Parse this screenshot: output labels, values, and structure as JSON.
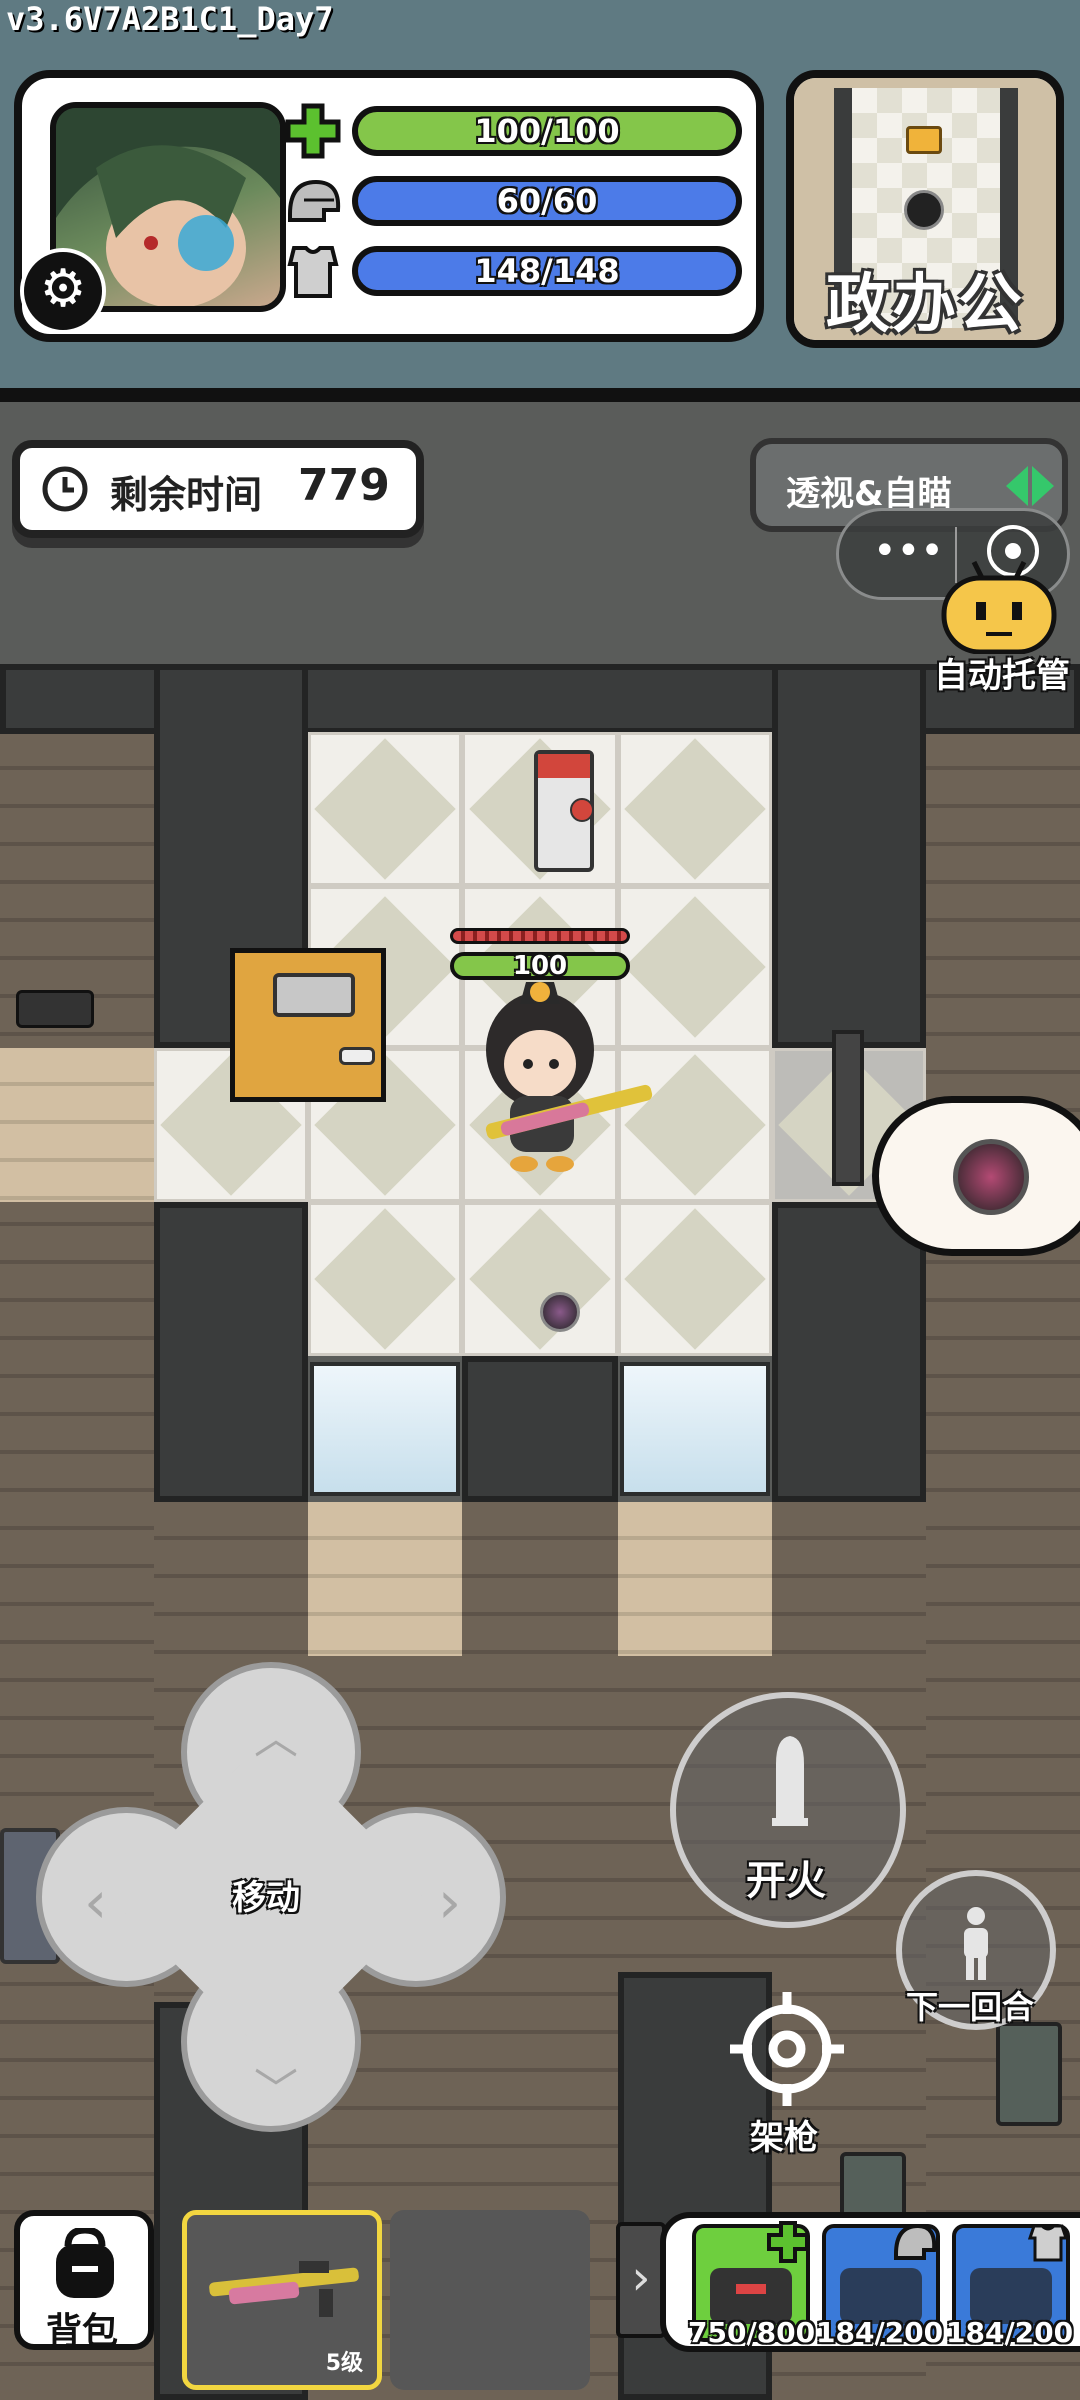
{
  "version": "v3.6V7A2B1C1_Day7",
  "stats": {
    "hp": "100/100",
    "helmet": "60/60",
    "armor": "148/148"
  },
  "minimap": {
    "label": "政办公"
  },
  "timer": {
    "label": "剩余时间",
    "value": "779"
  },
  "xray_button": {
    "label": "透视&自瞄"
  },
  "auto_manage": {
    "label": "自动托管"
  },
  "character": {
    "hp": "100"
  },
  "controls": {
    "move": "移动",
    "fire": "开火",
    "next_round": "下一回合",
    "aim": "架枪"
  },
  "bottom_bar": {
    "backpack": "背包",
    "weapon_level": "5级",
    "items": [
      {
        "name": "medkit",
        "count": "750/800"
      },
      {
        "name": "helmet-repair-kit",
        "count": "184/200"
      },
      {
        "name": "armor-repair-kit",
        "count": "184/200"
      }
    ]
  },
  "colors": {
    "hp_bar": "#84c64a",
    "shield_bar": "#4c7be8",
    "header_bg": "#5f7a82",
    "selected_slot": "#f2d640"
  }
}
